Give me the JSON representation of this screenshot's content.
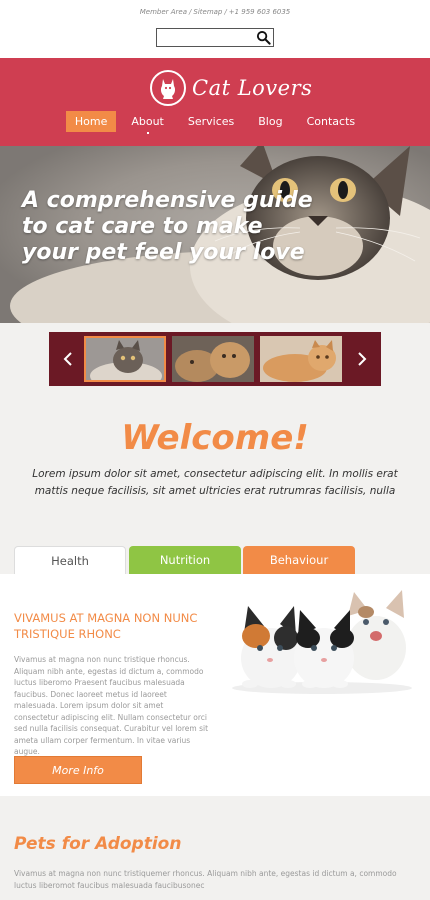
{
  "top": {
    "links": [
      "Member Area",
      "Sitemap",
      "+1 959 603 6035"
    ],
    "separator": "/",
    "search": {
      "placeholder": "",
      "value": ""
    }
  },
  "brand": {
    "name": "Cat Lovers",
    "accent": "#cf3e51"
  },
  "nav": {
    "items": [
      "Home",
      "About",
      "Services",
      "Blog",
      "Contacts"
    ],
    "active": "Home"
  },
  "hero": {
    "line1": "A comprehensive guide",
    "line2": "to cat care to make",
    "line3": "your pet feel your love"
  },
  "gallery": {
    "prev_icon": "chevron-left-icon",
    "next_icon": "chevron-right-icon"
  },
  "welcome": {
    "title": "Welcome!",
    "text": "Lorem ipsum dolor sit amet, consectetur adipiscing elit. In mollis erat mattis neque facilisis, sit amet ultricies erat rutrumras facilisis, nulla"
  },
  "tabs": [
    {
      "label": "Health",
      "color": "#ffffff"
    },
    {
      "label": "Nutrition",
      "color": "#8fc544"
    },
    {
      "label": "Behaviour",
      "color": "#f28b47"
    }
  ],
  "panel": {
    "title": "VIVAMUS AT MAGNA NON NUNC TRISTIQUE RHONC",
    "text": "Vivamus at magna non nunc tristique rhoncus. Aliquam nibh ante, egestas id dictum a, commodo luctus liberomo Praesent faucibus malesuada faucibus. Donec laoreet metus id laoreet malesuada. Lorem ipsum dolor sit amet consectetur adipiscing elit. Nullam consectetur orci sed nulla facilisis consequat. Curabitur vel lorem sit ameta ullam corper fermentum. In vitae varius augue.",
    "button": "More Info"
  },
  "adoption": {
    "title": "Pets for Adoption",
    "text": "Vivamus at magna non nunc tristiquemer rhoncus. Aliquam nibh ante, egestas id dictum a, commodo luctus liberomot faucibus malesuada faucibusonec"
  },
  "colors": {
    "orange": "#f28b47",
    "green": "#8fc544",
    "red": "#cf3e51",
    "maroon": "#6b1925"
  }
}
